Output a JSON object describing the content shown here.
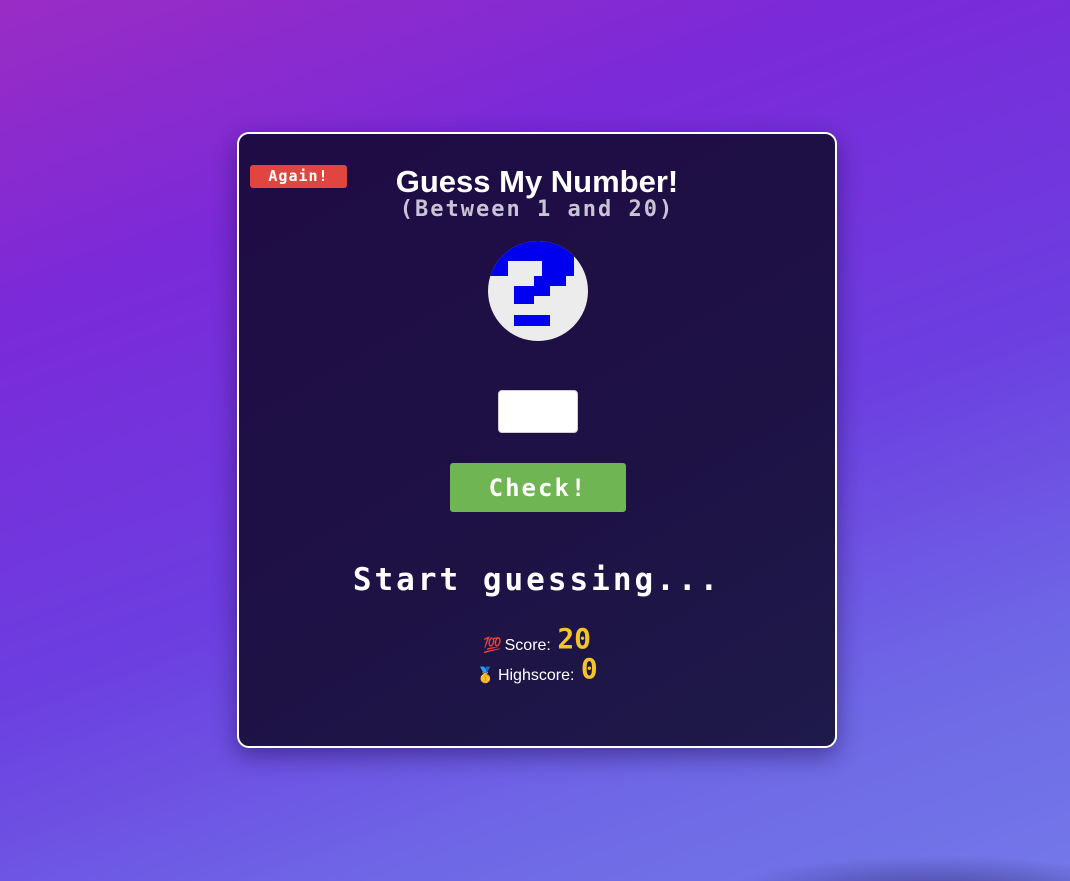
{
  "game": {
    "again_label": "Again!",
    "title": "Guess My Number!",
    "subtitle": "(Between 1 and 20)",
    "hidden_number": "?",
    "guess_value": "",
    "check_label": "Check!",
    "message": "Start guessing...",
    "score_emoji": "💯",
    "score_label": "Score:",
    "score_value": "20",
    "highscore_emoji": "🥇",
    "highscore_label": "Highscore:",
    "highscore_value": "0"
  },
  "colors": {
    "background_start": "#9a2cc4",
    "background_end": "#7378e8",
    "card_bg": "#1f0b45",
    "again_button": "#e0463f",
    "check_button": "#6fb553",
    "number_circle": "#ececec",
    "question_mark": "#0000ee",
    "score_value": "#f3c52a"
  },
  "icons": {
    "mystery": "pixel-question-mark-icon"
  }
}
